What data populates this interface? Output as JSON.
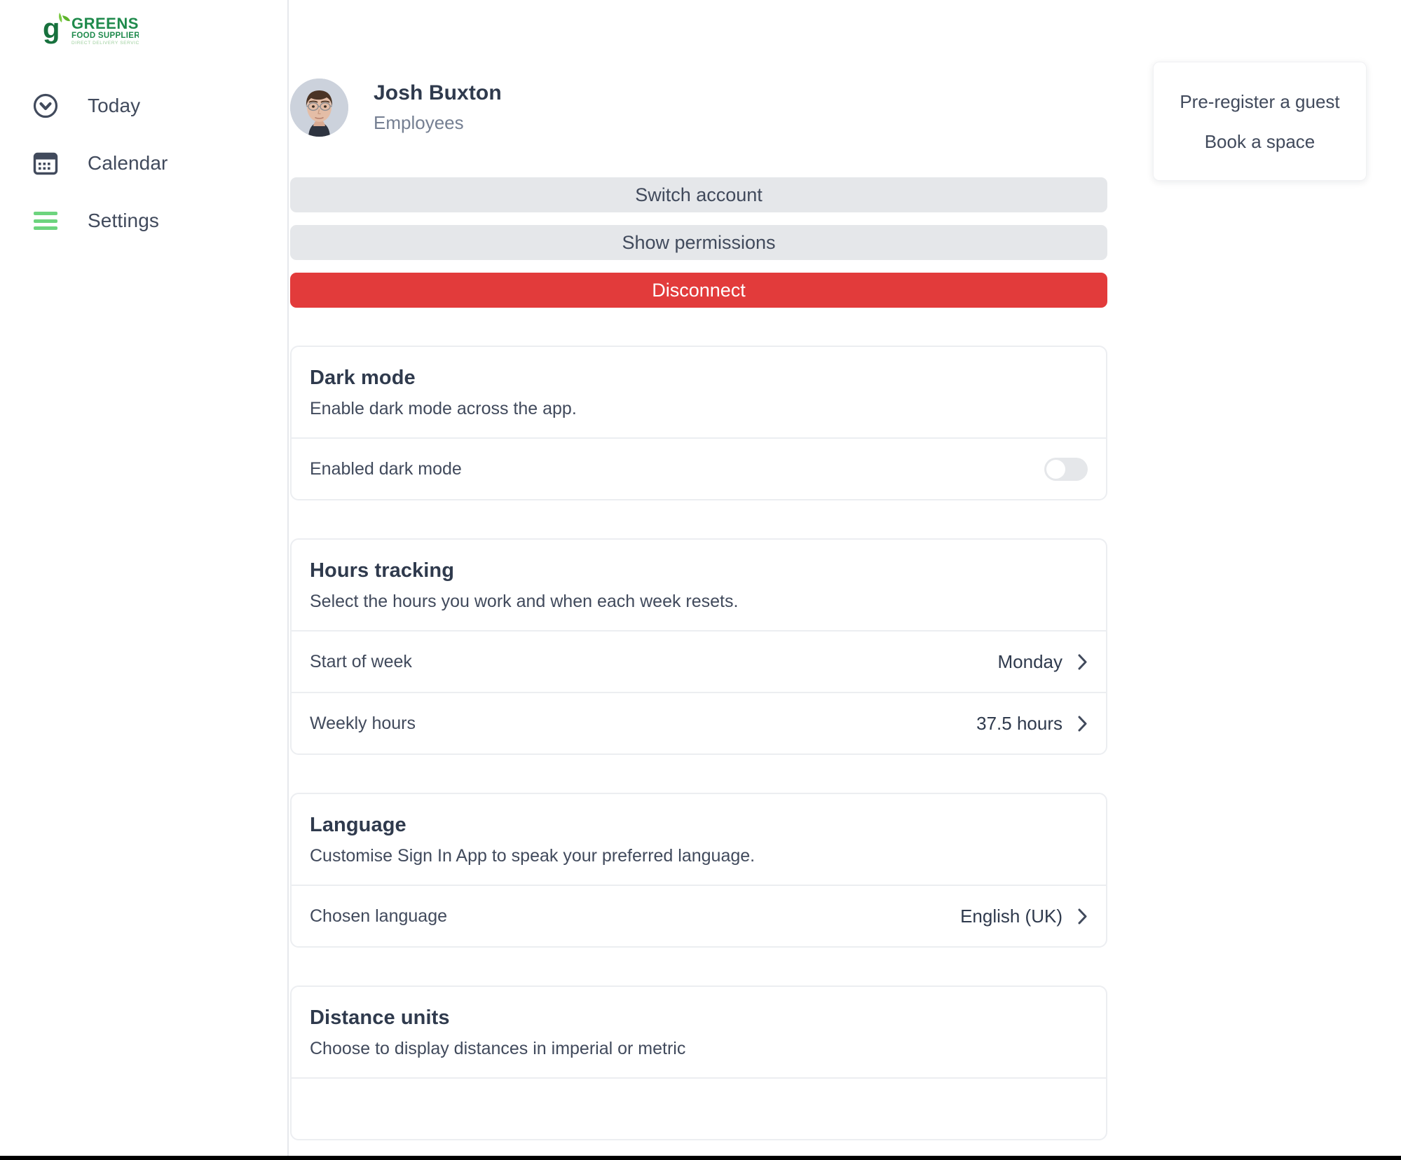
{
  "brand": {
    "name": "GREENS",
    "line2": "FOOD SUPPLIERS",
    "line3": "DIRECT DELIVERY SERVICE",
    "color": "#1f8a4c"
  },
  "sidebar": {
    "items": [
      {
        "label": "Today",
        "icon": "chevron-down-circle-icon"
      },
      {
        "label": "Calendar",
        "icon": "calendar-icon"
      },
      {
        "label": "Settings",
        "icon": "hamburger-menu-icon"
      }
    ]
  },
  "profile": {
    "name": "Josh Buxton",
    "group": "Employees"
  },
  "actions": {
    "switch_account": "Switch account",
    "show_permissions": "Show permissions",
    "disconnect": "Disconnect",
    "danger_color": "#e23b3b"
  },
  "cards": [
    {
      "title": "Dark mode",
      "description": "Enable dark mode across the app.",
      "rows": [
        {
          "label": "Enabled dark mode",
          "type": "toggle",
          "value": "off"
        }
      ]
    },
    {
      "title": "Hours tracking",
      "description": "Select the hours you work and when each week resets.",
      "rows": [
        {
          "label": "Start of week",
          "type": "link",
          "value": "Monday"
        },
        {
          "label": "Weekly hours",
          "type": "link",
          "value": "37.5 hours"
        }
      ]
    },
    {
      "title": "Language",
      "description": "Customise Sign In App to speak your preferred language.",
      "rows": [
        {
          "label": "Chosen language",
          "type": "link",
          "value": "English (UK)"
        }
      ]
    },
    {
      "title": "Distance units",
      "description": "Choose to display distances in imperial or metric",
      "rows": []
    }
  ],
  "right_panel": {
    "items": [
      {
        "label": "Pre-register a guest"
      },
      {
        "label": "Book a space"
      }
    ]
  }
}
